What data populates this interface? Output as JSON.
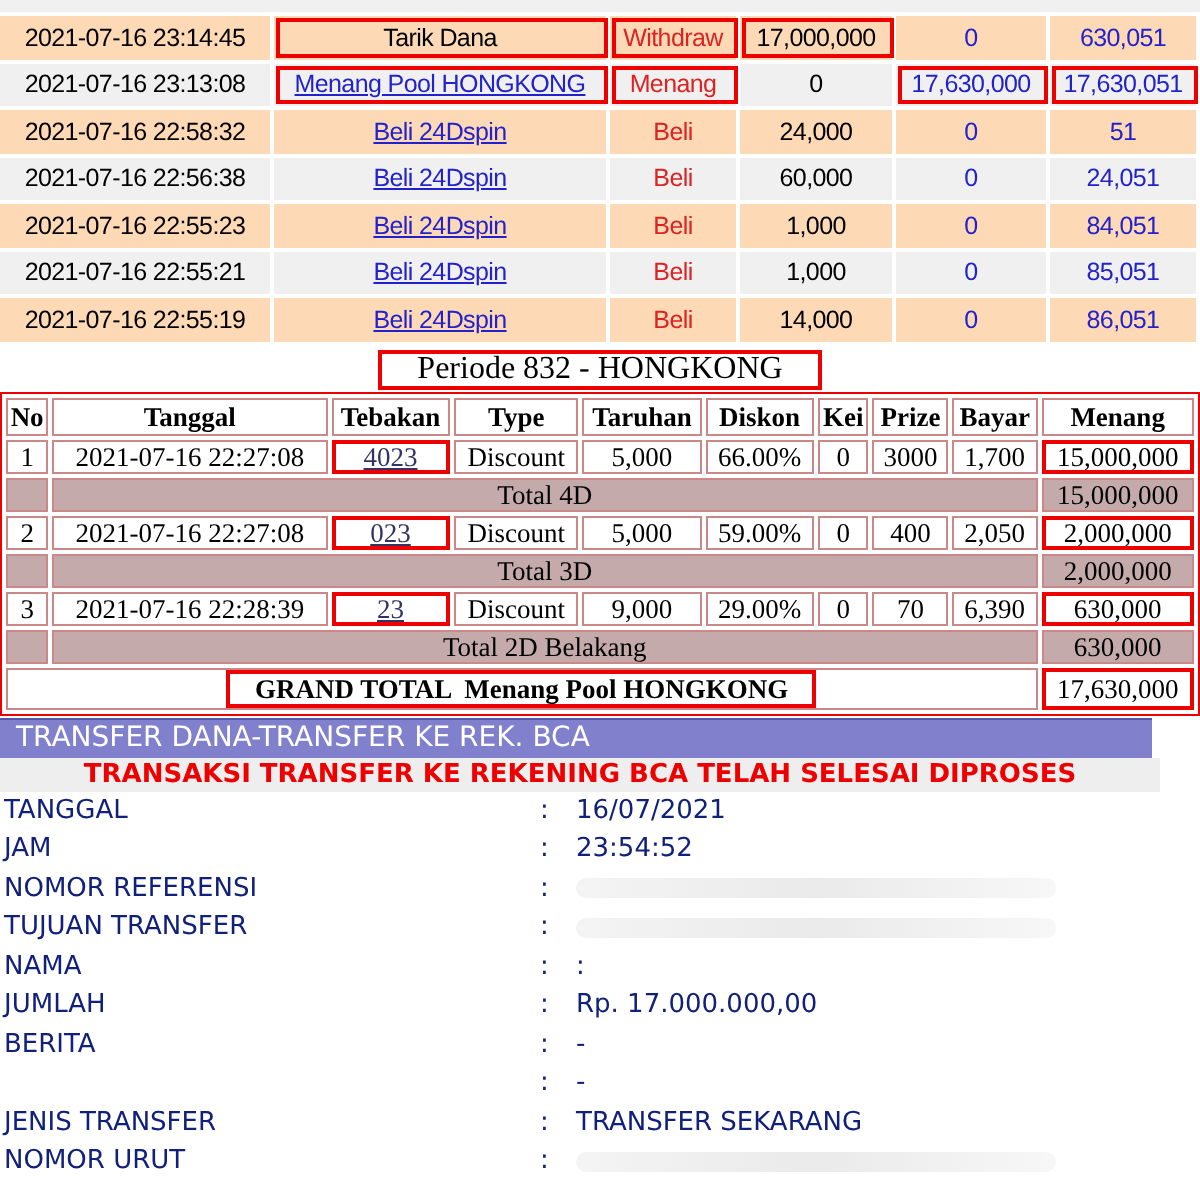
{
  "transactions": {
    "rows": [
      {
        "date": "2021-07-16 23:14:45",
        "description": "Tarik Dana",
        "description_link": false,
        "type": "Withdraw",
        "amount": "17,000,000",
        "credit": "0",
        "balance": "630,051",
        "highlight": {
          "description": true,
          "type": true,
          "amount": true,
          "credit": false,
          "balance": false
        }
      },
      {
        "date": "2021-07-16 23:13:08",
        "description": "Menang Pool HONGKONG",
        "description_link": true,
        "type": "Menang",
        "amount": "0",
        "credit": "17,630,000",
        "balance": "17,630,051",
        "highlight": {
          "description": true,
          "type": true,
          "amount": false,
          "credit": true,
          "balance": true
        }
      },
      {
        "date": "2021-07-16 22:58:32",
        "description": "Beli 24Dspin",
        "description_link": true,
        "type": "Beli",
        "amount": "24,000",
        "credit": "0",
        "balance": "51",
        "highlight": {
          "description": false,
          "type": false,
          "amount": false,
          "credit": false,
          "balance": false
        }
      },
      {
        "date": "2021-07-16 22:56:38",
        "description": "Beli 24Dspin",
        "description_link": true,
        "type": "Beli",
        "amount": "60,000",
        "credit": "0",
        "balance": "24,051",
        "highlight": {
          "description": false,
          "type": false,
          "amount": false,
          "credit": false,
          "balance": false
        }
      },
      {
        "date": "2021-07-16 22:55:23",
        "description": "Beli 24Dspin",
        "description_link": true,
        "type": "Beli",
        "amount": "1,000",
        "credit": "0",
        "balance": "84,051",
        "highlight": {
          "description": false,
          "type": false,
          "amount": false,
          "credit": false,
          "balance": false
        }
      },
      {
        "date": "2021-07-16 22:55:21",
        "description": "Beli 24Dspin",
        "description_link": true,
        "type": "Beli",
        "amount": "1,000",
        "credit": "0",
        "balance": "85,051",
        "highlight": {
          "description": false,
          "type": false,
          "amount": false,
          "credit": false,
          "balance": false
        }
      },
      {
        "date": "2021-07-16 22:55:19",
        "description": "Beli 24Dspin",
        "description_link": true,
        "type": "Beli",
        "amount": "14,000",
        "credit": "0",
        "balance": "86,051",
        "highlight": {
          "description": false,
          "type": false,
          "amount": false,
          "credit": false,
          "balance": false
        }
      }
    ]
  },
  "period": {
    "title": "Periode 832 - HONGKONG",
    "columns": [
      "No",
      "Tanggal",
      "Tebakan",
      "Type",
      "Taruhan",
      "Diskon",
      "Kei",
      "Prize",
      "Bayar",
      "Menang"
    ],
    "rows": [
      {
        "kind": "bet",
        "no": "1",
        "date": "2021-07-16 22:27:08",
        "guess": "4023",
        "type": "Discount",
        "stake": "5,000",
        "discount": "66.00%",
        "kei": "0",
        "prize": "3000",
        "pay": "1,700",
        "win": "15,000,000"
      },
      {
        "kind": "total",
        "label": "Total 4D",
        "win": "15,000,000"
      },
      {
        "kind": "bet",
        "no": "2",
        "date": "2021-07-16 22:27:08",
        "guess": "023",
        "type": "Discount",
        "stake": "5,000",
        "discount": "59.00%",
        "kei": "0",
        "prize": "400",
        "pay": "2,050",
        "win": "2,000,000"
      },
      {
        "kind": "total",
        "label": "Total 3D",
        "win": "2,000,000"
      },
      {
        "kind": "bet",
        "no": "3",
        "date": "2021-07-16 22:28:39",
        "guess": "23",
        "type": "Discount",
        "stake": "9,000",
        "discount": "29.00%",
        "kei": "0",
        "prize": "70",
        "pay": "6,390",
        "win": "630,000"
      },
      {
        "kind": "total",
        "label": "Total 2D Belakang",
        "win": "630,000"
      },
      {
        "kind": "grand",
        "label": "GRAND TOTAL  Menang Pool HONGKONG",
        "win": "17,630,000"
      }
    ]
  },
  "transfer": {
    "title": "TRANSFER DANA-TRANSFER KE REK. BCA",
    "status": "TRANSAKSI TRANSFER KE REKENING BCA TELAH SELESAI DIPROSES",
    "fields": [
      {
        "label": "TANGGAL",
        "separator": ":",
        "value": "16/07/2021",
        "blurred": false
      },
      {
        "label": "JAM",
        "separator": ":",
        "value": "23:54:52",
        "blurred": false
      },
      {
        "label": "NOMOR REFERENSI",
        "separator": ":",
        "blurred": true
      },
      {
        "label": "TUJUAN TRANSFER",
        "separator": ":",
        "blurred": true
      },
      {
        "label": "NAMA",
        "separator": ":",
        "value": ":",
        "blurred": false
      },
      {
        "label": "JUMLAH",
        "separator": ":",
        "value": "Rp. 17.000.000,00",
        "blurred": false
      },
      {
        "label": "BERITA",
        "separator": ":",
        "value": "-",
        "blurred": false
      },
      {
        "separator": ":",
        "value": "-",
        "blurred": false
      },
      {
        "label": "JENIS TRANSFER",
        "separator": ":",
        "value": "TRANSFER SEKARANG",
        "blurred": false
      },
      {
        "label": "NOMOR URUT",
        "separator": ":",
        "blurred": true
      }
    ]
  }
}
